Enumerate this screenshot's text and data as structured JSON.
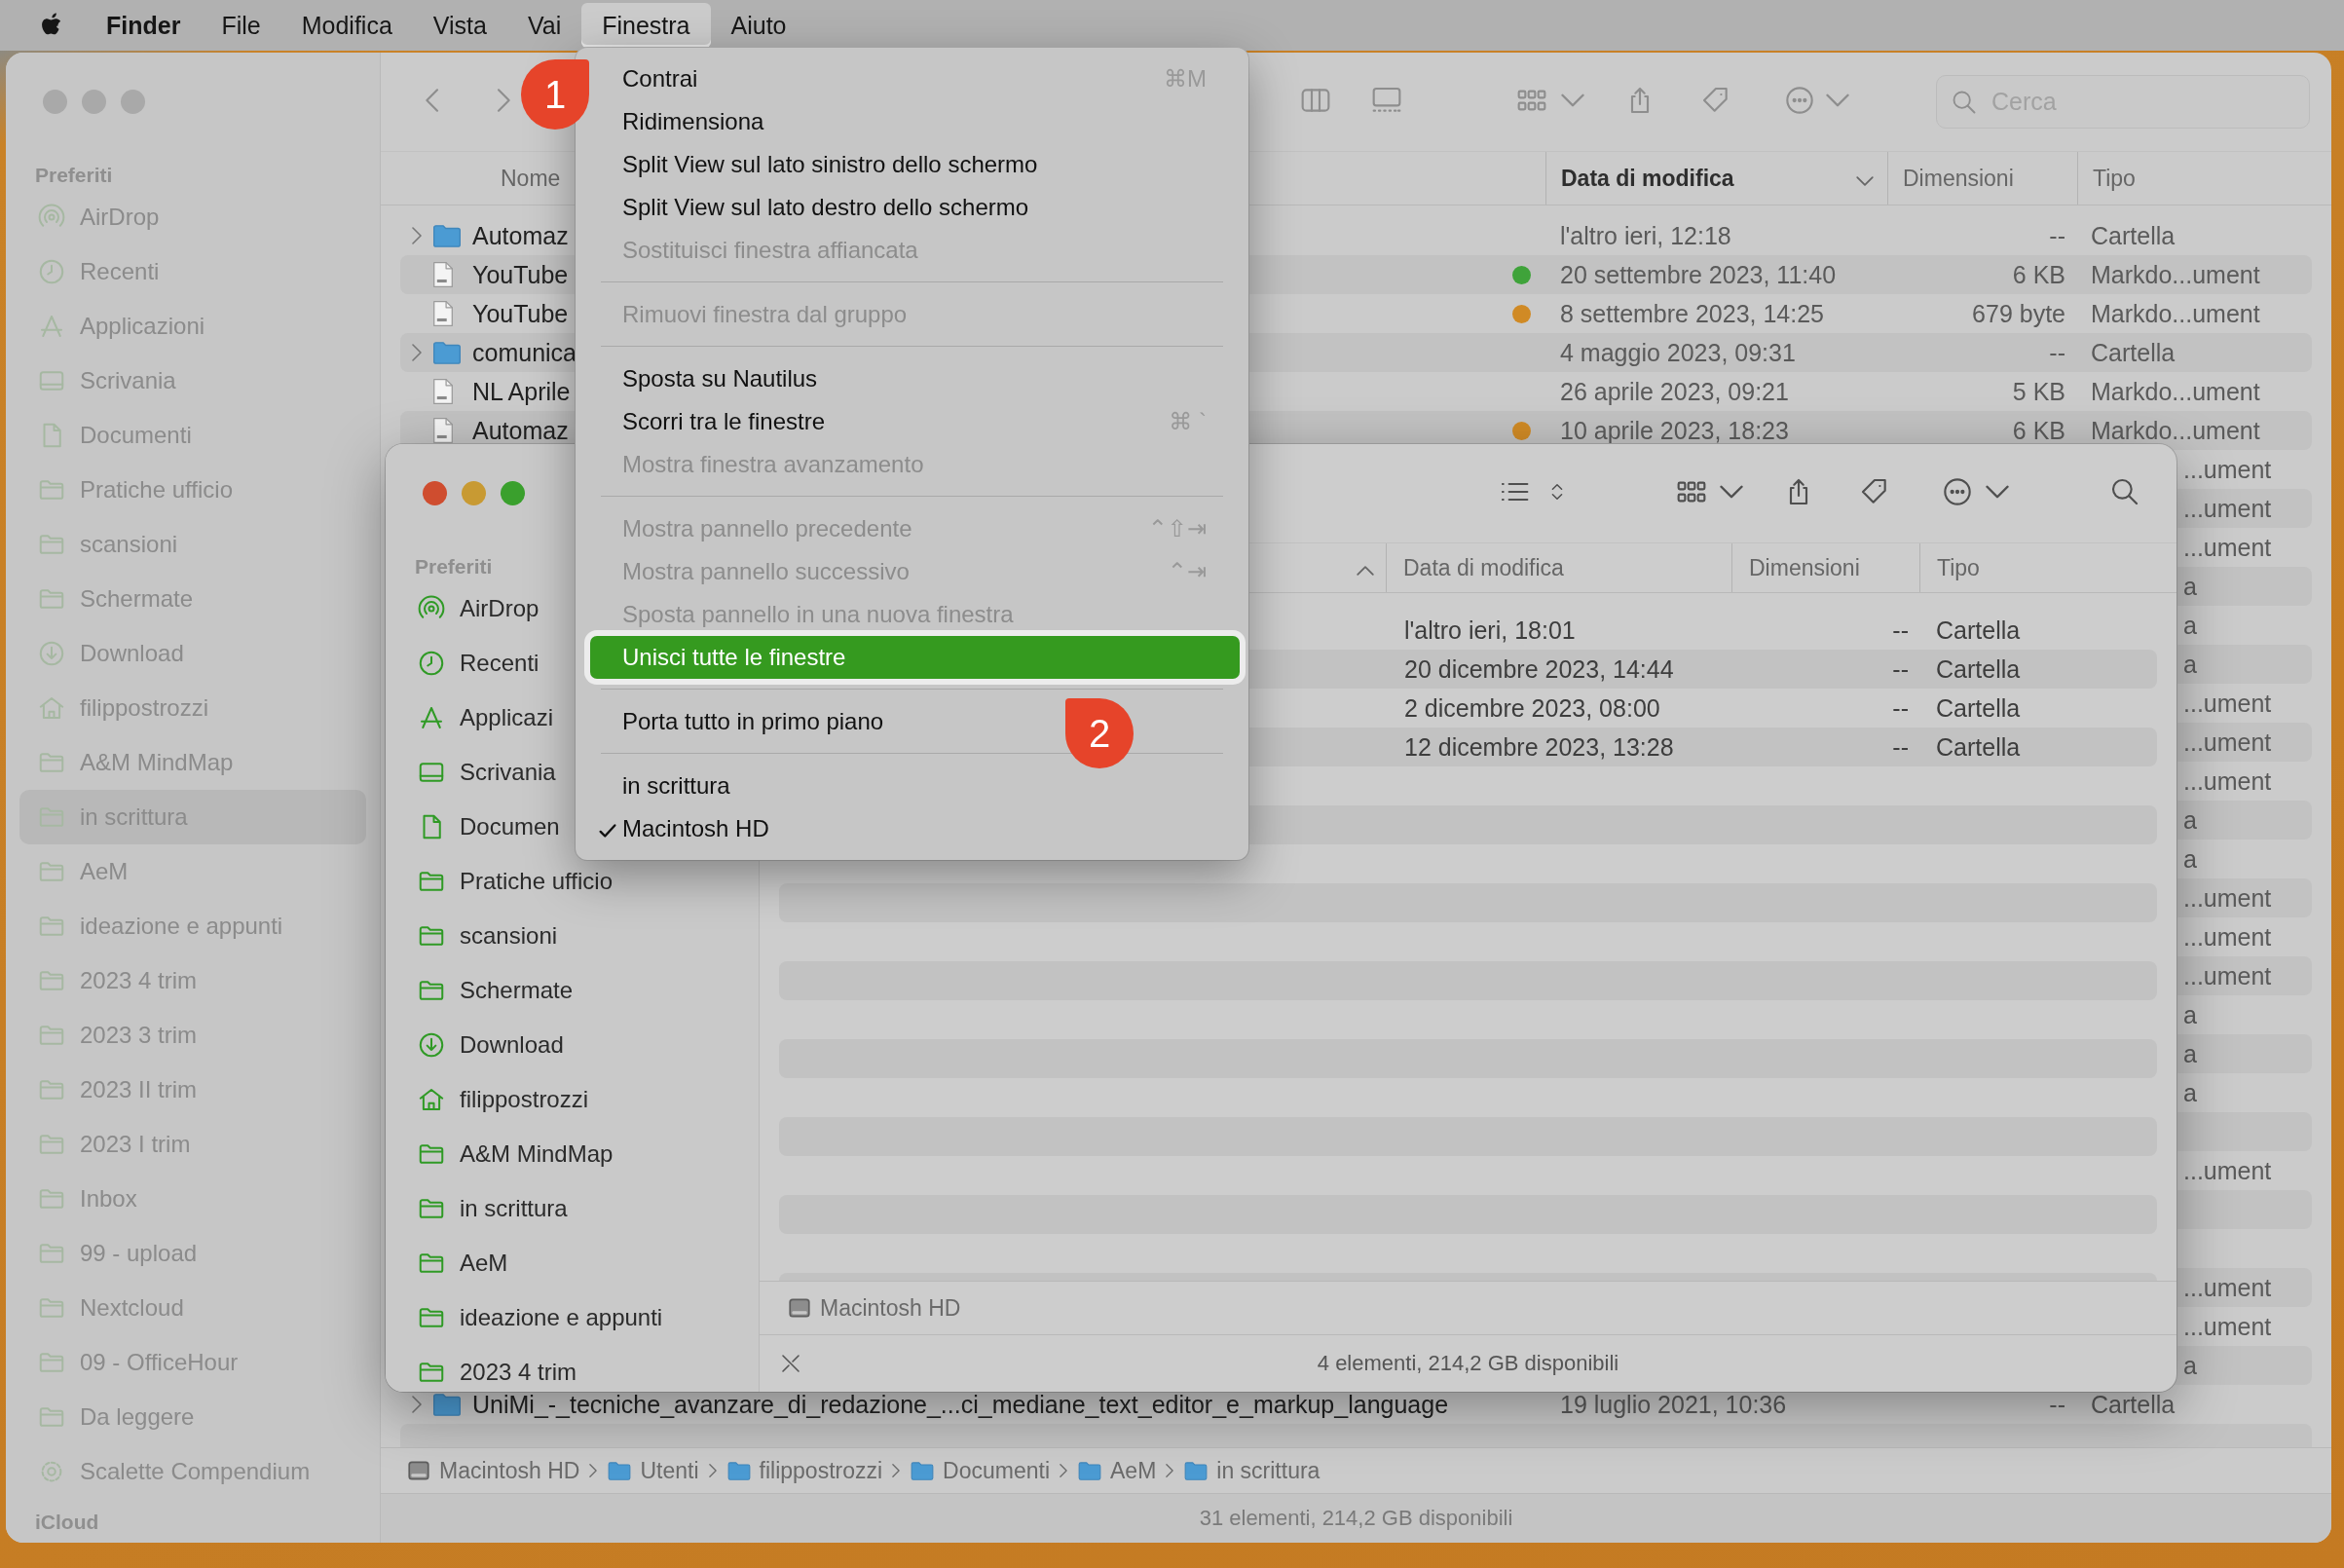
{
  "menubar": {
    "app": "Finder",
    "items": [
      {
        "label": "File",
        "selected": false
      },
      {
        "label": "Modifica",
        "selected": false
      },
      {
        "label": "Vista",
        "selected": false
      },
      {
        "label": "Vai",
        "selected": false
      },
      {
        "label": "Finestra",
        "selected": true
      },
      {
        "label": "Aiuto",
        "selected": false
      }
    ]
  },
  "back_window": {
    "sidebar": {
      "header": "Preferiti",
      "items": [
        {
          "label": "AirDrop",
          "kind": "airdrop",
          "selected": false
        },
        {
          "label": "Recenti",
          "kind": "clock",
          "selected": false
        },
        {
          "label": "Applicazioni",
          "kind": "apps",
          "selected": false
        },
        {
          "label": "Scrivania",
          "kind": "desktop",
          "selected": false
        },
        {
          "label": "Documenti",
          "kind": "document",
          "selected": false
        },
        {
          "label": "Pratiche ufficio",
          "kind": "folder",
          "selected": false
        },
        {
          "label": "scansioni",
          "kind": "folder",
          "selected": false
        },
        {
          "label": "Schermate",
          "kind": "folder",
          "selected": false
        },
        {
          "label": "Download",
          "kind": "download",
          "selected": false
        },
        {
          "label": "filippostrozzi",
          "kind": "home",
          "selected": false
        },
        {
          "label": "A&M MindMap",
          "kind": "folder",
          "selected": false
        },
        {
          "label": "in scrittura",
          "kind": "folder",
          "selected": true
        },
        {
          "label": "AeM",
          "kind": "folder",
          "selected": false
        },
        {
          "label": "ideazione e appunti",
          "kind": "folder",
          "selected": false
        },
        {
          "label": "2023 4 trim",
          "kind": "folder",
          "selected": false
        },
        {
          "label": "2023 3 trim",
          "kind": "folder",
          "selected": false
        },
        {
          "label": "2023 II trim",
          "kind": "folder",
          "selected": false
        },
        {
          "label": "2023 I trim",
          "kind": "folder",
          "selected": false
        },
        {
          "label": "Inbox",
          "kind": "folder",
          "selected": false
        },
        {
          "label": "99 - upload",
          "kind": "folder",
          "selected": false
        },
        {
          "label": "Nextcloud",
          "kind": "folder",
          "selected": false
        },
        {
          "label": "09 - OfficeHour",
          "kind": "folder",
          "selected": false
        },
        {
          "label": "Da leggere",
          "kind": "folder",
          "selected": false
        },
        {
          "label": "Scalette Compendium",
          "kind": "gear",
          "selected": false
        }
      ],
      "second_header": "iCloud"
    },
    "search": {
      "placeholder": "Cerca"
    },
    "sort_descending": true,
    "columns": [
      {
        "label": "Nome",
        "sorted": false
      },
      {
        "label": "Data di modifica",
        "sorted": true
      },
      {
        "label": "Dimensioni",
        "sorted": false
      },
      {
        "label": "Tipo",
        "sorted": false
      }
    ],
    "rows": [
      {
        "kind": "folder",
        "expandable": true,
        "name": "Automaz",
        "date": "l'altro ieri, 12:18",
        "size": "--",
        "type": "Cartella"
      },
      {
        "kind": "file",
        "expandable": false,
        "name": "YouTube",
        "color": "#3fa33a",
        "date": "20 settembre 2023, 11:40",
        "size": "6 KB",
        "type": "Markdo...ument"
      },
      {
        "kind": "file",
        "expandable": false,
        "name": "YouTube",
        "color": "#d08a25",
        "date": "8 settembre 2023, 14:25",
        "size": "679 byte",
        "type": "Markdo...ument"
      },
      {
        "kind": "folder",
        "expandable": true,
        "name": "comunica",
        "date": "4 maggio 2023, 09:31",
        "size": "--",
        "type": "Cartella"
      },
      {
        "kind": "file",
        "expandable": false,
        "name": "NL Aprile",
        "date": "26 aprile 2023, 09:21",
        "size": "5 KB",
        "type": "Markdo...ument"
      },
      {
        "kind": "file",
        "expandable": false,
        "name": "Automaz",
        "color": "#d08a25",
        "date": "10 aprile 2023, 18:23",
        "size": "6 KB",
        "type": "Markdo...ument"
      },
      {
        "kind": "covered",
        "type": "...ument"
      },
      {
        "kind": "covered",
        "type": "...ument"
      },
      {
        "kind": "covered",
        "type": "...ument"
      },
      {
        "kind": "covered",
        "type": "a"
      },
      {
        "kind": "covered",
        "type": "a"
      },
      {
        "kind": "covered",
        "type": "a"
      },
      {
        "kind": "covered",
        "type": "...ument"
      },
      {
        "kind": "covered",
        "type": "...ument"
      },
      {
        "kind": "covered",
        "type": "...ument"
      },
      {
        "kind": "covered",
        "type": "a"
      },
      {
        "kind": "covered",
        "type": "a"
      },
      {
        "kind": "covered",
        "type": "...ument"
      },
      {
        "kind": "covered",
        "type": "...ument"
      },
      {
        "kind": "covered",
        "type": "...ument"
      },
      {
        "kind": "covered",
        "type": "a"
      },
      {
        "kind": "covered",
        "type": "a"
      },
      {
        "kind": "covered",
        "type": "a"
      },
      {
        "kind": "covered"
      },
      {
        "kind": "covered",
        "type": "...ument"
      },
      {
        "kind": "covered"
      },
      {
        "kind": "covered"
      },
      {
        "kind": "covered",
        "type": "...ument"
      },
      {
        "kind": "covered",
        "type": "...ument"
      },
      {
        "kind": "covered",
        "type": "a"
      },
      {
        "kind": "folder",
        "expandable": true,
        "name": "UniMi_-_tecniche_avanzare_di_redazione_...ci_mediane_text_editor_e_markup_language",
        "date": "19 luglio 2021, 10:36",
        "size": "--",
        "type": "Cartella"
      }
    ],
    "path": [
      {
        "label": "Macintosh HD",
        "kind": "disk"
      },
      {
        "label": "Utenti",
        "kind": "folder"
      },
      {
        "label": "filippostrozzi",
        "kind": "folder"
      },
      {
        "label": "Documenti",
        "kind": "folder"
      },
      {
        "label": "AeM",
        "kind": "folder"
      },
      {
        "label": "in scrittura",
        "kind": "folder"
      }
    ],
    "status": "31 elementi, 214,2 GB disponibili"
  },
  "front_window": {
    "sidebar": {
      "header": "Preferiti",
      "items": [
        {
          "label": "AirDrop",
          "kind": "airdrop",
          "selected": false
        },
        {
          "label": "Recenti",
          "kind": "clock",
          "selected": false
        },
        {
          "label": "Applicazi",
          "kind": "apps",
          "selected": false
        },
        {
          "label": "Scrivania",
          "kind": "desktop",
          "selected": false
        },
        {
          "label": "Documen",
          "kind": "document",
          "selected": false
        },
        {
          "label": "Pratiche ufficio",
          "kind": "folder",
          "selected": false
        },
        {
          "label": "scansioni",
          "kind": "folder",
          "selected": false
        },
        {
          "label": "Schermate",
          "kind": "folder",
          "selected": false
        },
        {
          "label": "Download",
          "kind": "download",
          "selected": false
        },
        {
          "label": "filippostrozzi",
          "kind": "home",
          "selected": false
        },
        {
          "label": "A&M MindMap",
          "kind": "folder",
          "selected": false
        },
        {
          "label": "in scrittura",
          "kind": "folder",
          "selected": false
        },
        {
          "label": "AeM",
          "kind": "folder",
          "selected": false
        },
        {
          "label": "ideazione e appunti",
          "kind": "folder",
          "selected": false
        },
        {
          "label": "2023 4 trim",
          "kind": "folder",
          "selected": false
        }
      ]
    },
    "sort_descending": false,
    "columns": [
      {
        "sorted": true
      },
      {
        "label": "Data di modifica",
        "sorted": false
      },
      {
        "label": "Dimensioni",
        "sorted": false
      },
      {
        "label": "Tipo",
        "sorted": false
      }
    ],
    "rows": [
      {
        "date": "l'altro ieri, 18:01",
        "size": "--",
        "type": "Cartella"
      },
      {
        "date": "20 dicembre 2023, 14:44",
        "size": "--",
        "type": "Cartella"
      },
      {
        "date": "2 dicembre 2023, 08:00",
        "size": "--",
        "type": "Cartella"
      },
      {
        "date": "12 dicembre 2023, 13:28",
        "size": "--",
        "type": "Cartella"
      }
    ],
    "path": [
      {
        "label": "Macintosh HD",
        "kind": "disk"
      }
    ],
    "status": "4 elementi, 214,2 GB disponibili"
  },
  "menu": {
    "items": [
      {
        "kind": "item",
        "label": "Contrai",
        "shortcut": "⌘M",
        "disabled": false,
        "selected": false,
        "checked": false
      },
      {
        "kind": "item",
        "label": "Ridimensiona",
        "disabled": false,
        "selected": false,
        "checked": false
      },
      {
        "kind": "item",
        "label": "Split View sul lato sinistro dello schermo",
        "disabled": false,
        "selected": false,
        "checked": false
      },
      {
        "kind": "item",
        "label": "Split View sul lato destro dello schermo",
        "disabled": false,
        "selected": false,
        "checked": false
      },
      {
        "kind": "item",
        "label": "Sostituisci finestra affiancata",
        "disabled": true,
        "selected": false,
        "checked": false
      },
      {
        "kind": "separator"
      },
      {
        "kind": "item",
        "label": "Rimuovi finestra dal gruppo",
        "disabled": true,
        "selected": false,
        "checked": false
      },
      {
        "kind": "separator"
      },
      {
        "kind": "item",
        "label": "Sposta su Nautilus",
        "disabled": false,
        "selected": false,
        "checked": false
      },
      {
        "kind": "item",
        "label": "Scorri tra le finestre",
        "shortcut": "⌘ `",
        "disabled": false,
        "selected": false,
        "checked": false
      },
      {
        "kind": "item",
        "label": "Mostra finestra avanzamento",
        "disabled": true,
        "selected": false,
        "checked": false
      },
      {
        "kind": "separator"
      },
      {
        "kind": "item",
        "label": "Mostra pannello precedente",
        "shortcut": "⌃⇧⇥",
        "disabled": true,
        "selected": false,
        "checked": false
      },
      {
        "kind": "item",
        "label": "Mostra pannello successivo",
        "shortcut": "⌃⇥",
        "disabled": true,
        "selected": false,
        "checked": false
      },
      {
        "kind": "item",
        "label": "Sposta pannello in una nuova finestra",
        "disabled": true,
        "selected": false,
        "checked": false
      },
      {
        "kind": "item",
        "label": "Unisci tutte le finestre",
        "disabled": false,
        "selected": true,
        "checked": false
      },
      {
        "kind": "separator"
      },
      {
        "kind": "item",
        "label": "Porta tutto in primo piano",
        "disabled": false,
        "selected": false,
        "checked": false
      },
      {
        "kind": "separator"
      },
      {
        "kind": "item",
        "label": "in scrittura",
        "disabled": false,
        "selected": false,
        "checked": false
      },
      {
        "kind": "item",
        "label": "Macintosh HD",
        "disabled": false,
        "selected": false,
        "checked": true
      }
    ]
  },
  "badges": [
    {
      "label": "1"
    },
    {
      "label": "2"
    }
  ]
}
